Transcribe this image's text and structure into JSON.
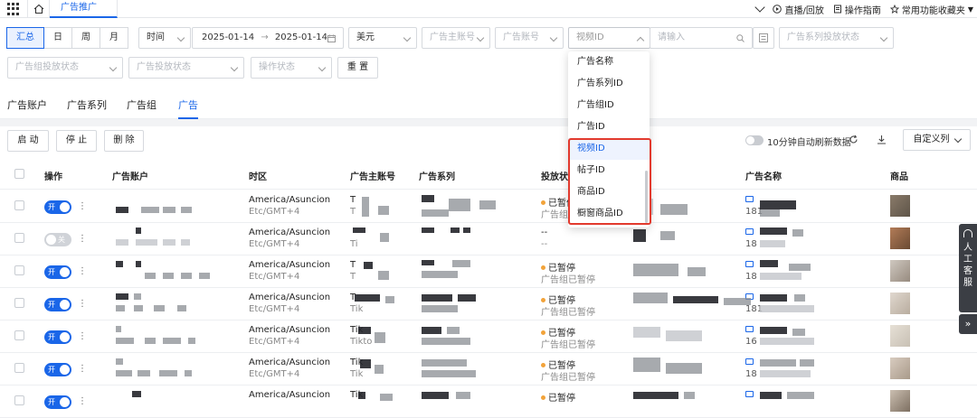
{
  "topbar": {
    "active_tab": "广告推广",
    "live": "直播/回放",
    "guide": "操作指南",
    "favorites": "常用功能收藏夹"
  },
  "filters": {
    "segments": [
      "汇总",
      "日",
      "周",
      "月"
    ],
    "time_label": "时间",
    "date_start": "2025-01-14",
    "date_arrow": "→",
    "date_end": "2025-01-14",
    "currency": "美元",
    "main_account_ph": "广告主账号",
    "account_ph": "广告账号",
    "id_type": "视频ID",
    "search_ph": "请输入",
    "series_status_ph": "广告系列投放状态",
    "group_status_ph": "广告组投放状态",
    "ad_status_ph": "广告投放状态",
    "op_status_ph": "操作状态",
    "reset": "重 置"
  },
  "dropdown": {
    "items": [
      "广告名称",
      "广告系列ID",
      "广告组ID",
      "广告ID",
      "视频ID",
      "帖子ID",
      "商品ID",
      "橱窗商品ID"
    ],
    "selected": "视频ID"
  },
  "tabs": [
    "广告账户",
    "广告系列",
    "广告组",
    "广告"
  ],
  "actions": {
    "start": "启 动",
    "stop": "停 止",
    "delete": "删 除",
    "auto_refresh": "10分钟自动刷新数据",
    "custom_cols": "自定义列"
  },
  "table": {
    "headers": [
      "操作",
      "广告账户",
      "时区",
      "广告主账号",
      "广告系列",
      "投放状态",
      "广告名称",
      "商品"
    ],
    "rows": [
      {
        "toggle": "开",
        "on": true,
        "tz": "America/Asuncion",
        "tz2": "Etc/GMT+4",
        "acct": "T",
        "acct2": "T",
        "st": "已暂停",
        "st2": "广告组",
        "num": "181"
      },
      {
        "toggle": "关",
        "on": false,
        "tz": "America/Asuncion",
        "tz2": "Etc/GMT+4",
        "acct": "",
        "acct2": "Ti",
        "st": "--",
        "st2": "--",
        "num": "18"
      },
      {
        "toggle": "开",
        "on": true,
        "tz": "America/Asuncion",
        "tz2": "Etc/GMT+4",
        "acct": "T",
        "acct2": "T",
        "st": "已暂停",
        "st2": "广告组已暂停",
        "num": "18"
      },
      {
        "toggle": "开",
        "on": true,
        "tz": "America/Asuncion",
        "tz2": "Etc/GMT+4",
        "acct": "T",
        "acct2": "Tik",
        "st": "已暂停",
        "st2": "广告组已暂停",
        "num": "181"
      },
      {
        "toggle": "开",
        "on": true,
        "tz": "America/Asuncion",
        "tz2": "Etc/GMT+4",
        "acct": "Tik",
        "acct2": "Tikto",
        "st": "已暂停",
        "st2": "广告组已暂停",
        "num": "16"
      },
      {
        "toggle": "开",
        "on": true,
        "tz": "America/Asuncion",
        "tz2": "Etc/GMT+4",
        "acct": "Tik",
        "acct2": "Tik",
        "st": "已暂停",
        "st2": "广告组已暂停",
        "num": "18"
      },
      {
        "toggle": "开",
        "on": true,
        "tz": "America/Asuncion",
        "tz2": "",
        "acct": "Tik",
        "acct2": "",
        "st": "已暂停",
        "st2": "",
        "num": ""
      }
    ]
  },
  "support": {
    "label": "人工客服",
    "collapse": "»"
  }
}
